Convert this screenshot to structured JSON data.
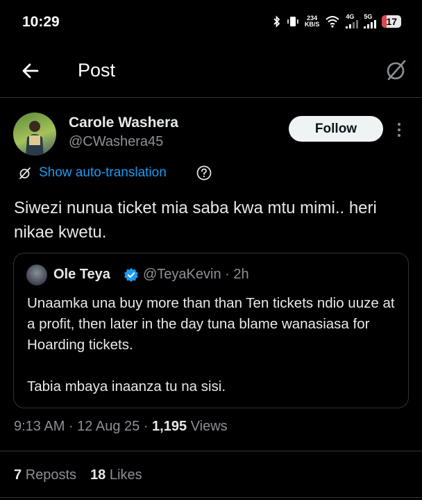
{
  "status_bar": {
    "time": "10:29",
    "speed_value": "234",
    "speed_unit": "KB/S",
    "net1": "4G",
    "net2": "5G",
    "battery": "17"
  },
  "header": {
    "title": "Post"
  },
  "post": {
    "author_name": "Carole Washera",
    "author_handle": "@CWashera45",
    "follow_label": "Follow",
    "translate_label": "Show auto-translation",
    "text": "Siwezi nunua ticket mia saba kwa mtu mimi.. heri nikae kwetu."
  },
  "quote": {
    "name": "Ole Teya",
    "handle": "@TeyaKevin",
    "time": " · 2h",
    "paragraph1": "Unaamka una buy more than than Ten tickets ndio uuze at a profit, then later in the day tuna blame wanasiasa for Hoarding tickets.",
    "paragraph2": "Tabia mbaya inaanza tu na sisi."
  },
  "meta": {
    "time": "9:13 AM",
    "date": "12 Aug 25",
    "views_count": "1,195",
    "views_label": "Views"
  },
  "stats": {
    "reposts_count": "7",
    "reposts_label": "Reposts",
    "likes_count": "18",
    "likes_label": "Likes"
  },
  "colors": {
    "background": "#000000",
    "link": "#1d9bf0",
    "muted": "#8b9196",
    "verified": "#1d9bf0"
  }
}
